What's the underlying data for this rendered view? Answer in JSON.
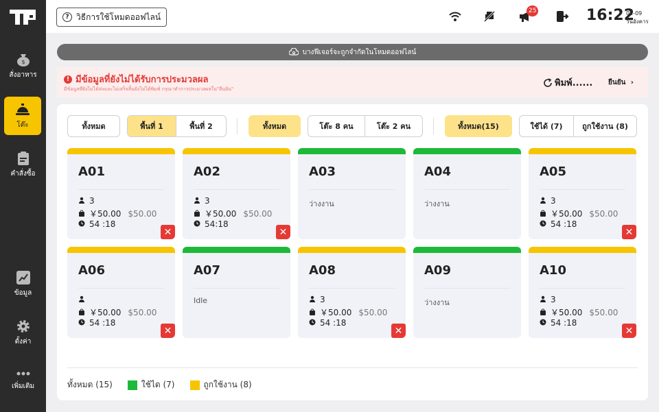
{
  "sidebar": {
    "items": [
      {
        "label": "สั่งอาหาร",
        "icon": "money-bag-icon"
      },
      {
        "label": "โต๊ะ",
        "icon": "service-bell-icon"
      },
      {
        "label": "คำสั่งซื้อ",
        "icon": "clipboard-icon"
      },
      {
        "label": "ข้อมูล",
        "icon": "chart-icon"
      },
      {
        "label": "ตั้งค่า",
        "icon": "gear-icon"
      },
      {
        "label": "เพิ่มเติม",
        "icon": "more-dots-icon"
      }
    ],
    "active_index": 1
  },
  "topbar": {
    "help_label": "วิธีการใช้โหมดออฟไลน์",
    "notification_count": "25",
    "time": "16:22",
    "date_top": "01-09",
    "date_bottom": "วันอังคาร"
  },
  "offline_banner": "บางฟีเจอร์จะถูกจำกัดในโหมดออฟไลน์",
  "alert": {
    "title": "มีข้อมูลที่ยังไม่ได้รับการประมวลผล",
    "subtitle": "มีข้อมูลที่ยังไม่ได้ส่งและไม่เสร็จสิ้นยังไม่ได้พิมพ์ กรุณาทำการประมวลผลใน\"ยืนยัน\"",
    "print_label": "พิมพ์......",
    "confirm_label": "ยืนยัน"
  },
  "filters": {
    "all_label": "ทั้งหมด",
    "floors": [
      "พื้นที่ 1",
      "พื้นที่ 2"
    ],
    "size_all": "ทั้งหมด",
    "sizes": [
      "โต๊ะ 8 คน",
      "โต๊ะ 2 คน"
    ],
    "status_all": "ทั้งหมด(15)",
    "status_free": "ใช้ได้ (7)",
    "status_used": "ถูกใช้งาน (8)"
  },
  "tables": [
    {
      "name": "A01",
      "state": "busy",
      "guests": "3",
      "price": "￥50.00",
      "orig": "$50.00",
      "time": "54 :18"
    },
    {
      "name": "A02",
      "state": "busy",
      "guests": "3",
      "price": "￥50.00",
      "orig": "$50.00",
      "time": "54:18"
    },
    {
      "name": "A03",
      "state": "free",
      "status": "ว่างงาน"
    },
    {
      "name": "A04",
      "state": "free",
      "status": "ว่างงาน"
    },
    {
      "name": "A05",
      "state": "busy",
      "guests": "3",
      "price": "￥50.00",
      "orig": "$50.00",
      "time": "54 :18"
    },
    {
      "name": "A06",
      "state": "busy",
      "guests": "",
      "price": "￥50.00",
      "orig": "$50.00",
      "time": "54 :18"
    },
    {
      "name": "A07",
      "state": "free",
      "status": "Idle"
    },
    {
      "name": "A08",
      "state": "busy",
      "guests": "3",
      "price": "￥50.00",
      "orig": "$50.00",
      "time": "54 :18"
    },
    {
      "name": "A09",
      "state": "free",
      "status": "ว่างงาน"
    },
    {
      "name": "A10",
      "state": "busy",
      "guests": "3",
      "price": "￥50.00",
      "orig": "$50.00",
      "time": "54 :18"
    }
  ],
  "legend": {
    "all": "ทั้งหมด (15)",
    "free": "ใช้ได (7)",
    "used": "ถูกใช้งาน (8)"
  },
  "colors": {
    "accent": "#f7c500",
    "busy": "#f7c500",
    "free": "#1db93a",
    "danger": "#e53935"
  }
}
